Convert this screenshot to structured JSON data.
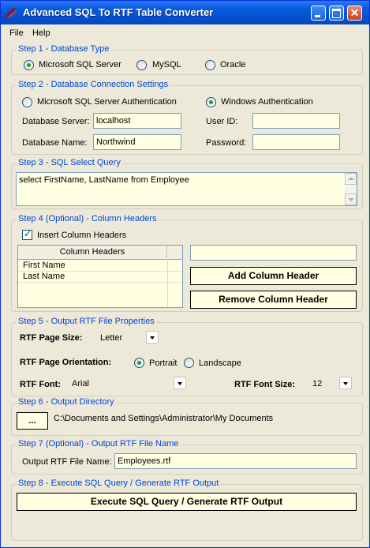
{
  "window": {
    "title": "Advanced SQL To RTF Table Converter",
    "menu": [
      "File",
      "Help"
    ]
  },
  "step1": {
    "legend": "Step 1 - Database Type",
    "options": [
      "Microsoft SQL Server",
      "MySQL",
      "Oracle"
    ],
    "selected": "Microsoft SQL Server"
  },
  "step2": {
    "legend": "Step 2 - Database Connection Settings",
    "auth_options": [
      "Microsoft SQL Server Authentication",
      "Windows Authentication"
    ],
    "auth_selected": "Windows Authentication",
    "server_label": "Database Server:",
    "server_value": "localhost",
    "dbname_label": "Database Name:",
    "dbname_value": "Northwind",
    "userid_label": "User ID:",
    "userid_value": "",
    "password_label": "Password:",
    "password_value": ""
  },
  "step3": {
    "legend": "Step 3 - SQL Select Query",
    "query": "select FirstName, LastName from Employee"
  },
  "step4": {
    "legend": "Step 4 (Optional) - Column Headers",
    "insert_label": "Insert Column Headers",
    "insert_checked": true,
    "grid_header": "Column Headers",
    "rows": [
      "First Name",
      "Last Name"
    ],
    "new_header_value": "",
    "add_button": "Add Column Header",
    "remove_button": "Remove Column Header"
  },
  "step5": {
    "legend": "Step 5 - Output RTF File Properties",
    "page_size_label": "RTF Page Size:",
    "page_size_value": "Letter",
    "orientation_label": "RTF Page Orientation:",
    "orientation_options": [
      "Portrait",
      "Landscape"
    ],
    "orientation_selected": "Portrait",
    "font_label": "RTF Font:",
    "font_value": "Arial",
    "font_size_label": "RTF Font Size:",
    "font_size_value": "12"
  },
  "step6": {
    "legend": "Step 6 - Output Directory",
    "browse_button": "...",
    "directory": "C:\\Documents and Settings\\Administrator\\My Documents"
  },
  "step7": {
    "legend": "Step 7 (Optional) - Output RTF File Name",
    "filename_label": "Output RTF File Name:",
    "filename_value": "Employees.rtf"
  },
  "step8": {
    "legend": "Step 8 - Execute SQL Query / Generate RTF Output",
    "execute_button": "Execute SQL Query / Generate RTF Output"
  },
  "colors": {
    "titlebar": "#0a5de0",
    "legend_text": "#0046d5",
    "input_background": "#ffffe1",
    "window_background": "#ece9d8",
    "radio_check": "#21a121"
  }
}
